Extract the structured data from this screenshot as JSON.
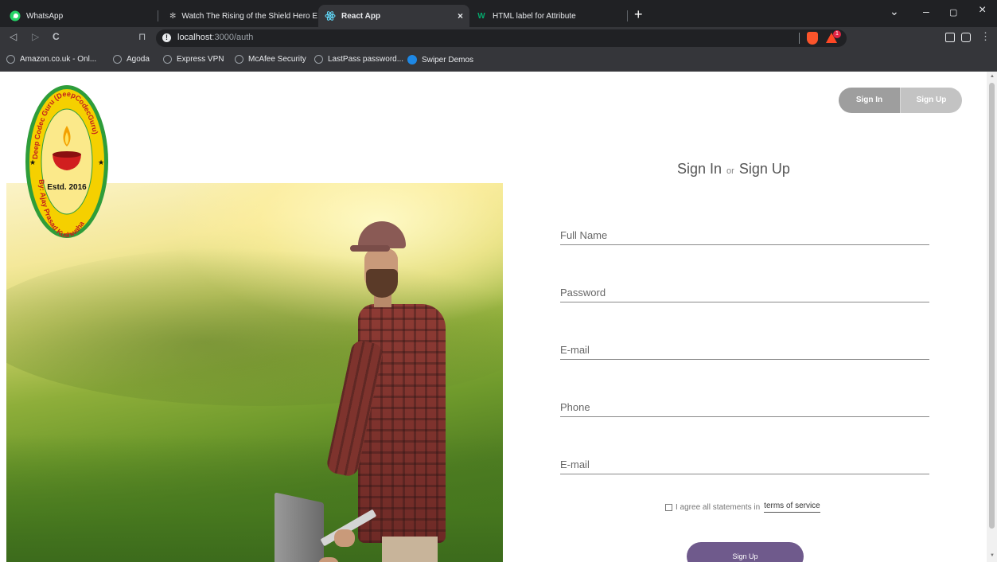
{
  "browser": {
    "tabs": [
      {
        "title": "WhatsApp",
        "icon": "whatsapp-icon"
      },
      {
        "title": "Watch The Rising of the Shield Hero E",
        "icon": "anime-site-icon"
      },
      {
        "title": "React App",
        "icon": "react-icon",
        "active": true,
        "close": "×"
      },
      {
        "title": "HTML label for Attribute",
        "icon": "w3schools-icon"
      }
    ],
    "new_tab": "+",
    "controls": {
      "collapse": "⌄",
      "minimize": "–",
      "maximize": "▢",
      "close": "×"
    },
    "nav": {
      "back": "◁",
      "forward": "▷",
      "reload": "C",
      "bookmark": "⊓"
    },
    "address": {
      "host": "localhost",
      "path": ":3000/auth",
      "info": "!"
    },
    "rewards_count": "1",
    "bookmarks": [
      "Amazon.co.uk - Onl...",
      "Agoda",
      "Express VPN",
      "McAfee Security",
      "LastPass password...",
      "Swiper Demos"
    ],
    "menu": "⋮"
  },
  "logo": {
    "arc_top": "Deep Codec Guru (DeepCodecGuru)",
    "arc_bottom": "By: Ajay Prasad Kushwaha",
    "estd": "Estd. 2016"
  },
  "auth": {
    "toggle": {
      "signin": "Sign In",
      "signup": "Sign Up"
    },
    "title": {
      "signin": "Sign In",
      "or": "or",
      "signup": "Sign Up"
    },
    "fields": {
      "full_name": "Full Name",
      "password": "Password",
      "email": "E-mail",
      "phone": "Phone",
      "email2": "E-mail"
    },
    "terms": {
      "text": "I agree all statements in",
      "link": "terms of service"
    },
    "submit": "Sign Up"
  },
  "colors": {
    "toggle_signin": "#9e9e9e",
    "toggle_signup": "#c3c3c3",
    "submit": "#6f5a8c",
    "logo_ring": "#2e9d3a",
    "logo_inner": "#f5d000"
  }
}
